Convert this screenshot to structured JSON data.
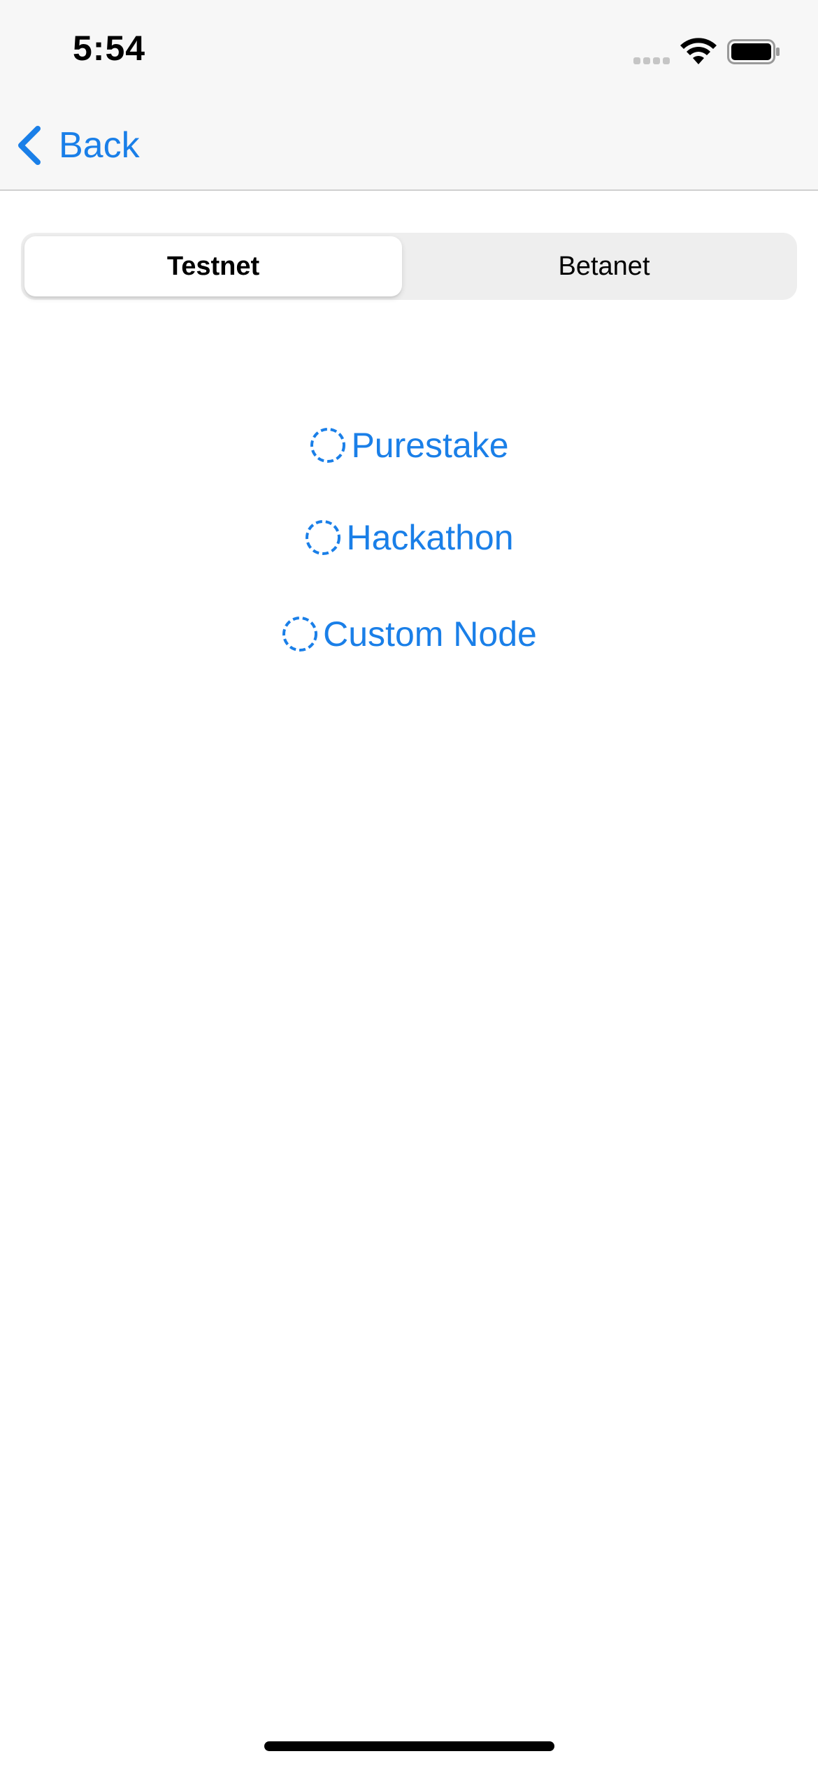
{
  "status_bar": {
    "time": "5:54",
    "signal_icon": "cellular-signal-icon",
    "wifi_icon": "wifi-icon",
    "battery_icon": "battery-icon"
  },
  "nav": {
    "back_label": "Back",
    "back_icon": "chevron-left-icon"
  },
  "segmented_control": {
    "segments": [
      {
        "label": "Testnet",
        "selected": true
      },
      {
        "label": "Betanet",
        "selected": false
      }
    ]
  },
  "node_options": [
    {
      "label": "Purestake",
      "icon": "dashed-circle-icon"
    },
    {
      "label": "Hackathon",
      "icon": "dashed-circle-icon"
    },
    {
      "label": "Custom Node",
      "icon": "dashed-circle-icon"
    }
  ],
  "colors": {
    "accent": "#1a7fe8",
    "nav_background": "#f7f7f7",
    "segment_background": "#eeeeee",
    "text": "#000000"
  }
}
